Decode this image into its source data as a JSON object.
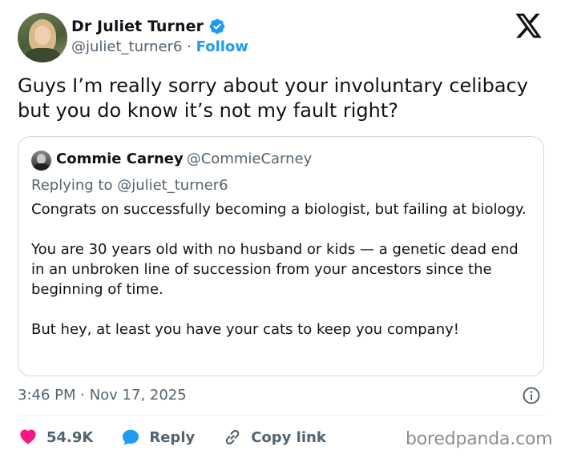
{
  "author": {
    "display_name": "Dr Juliet Turner",
    "handle": "@juliet_turner6",
    "separator": "·",
    "follow_label": "Follow"
  },
  "tweet": {
    "text": "Guys I’m really sorry about your involuntary celibacy but you do know it’s not my fault right?"
  },
  "quote": {
    "name": "Commie Carney",
    "handle": "@CommieCarney",
    "replying_to": "Replying to @juliet_turner6",
    "paragraphs": [
      "Congrats on successfully becoming a biologist, but failing at biology.",
      "You are 30 years old with no husband or kids — a genetic dead end in an unbroken line of succession from your ancestors since the beginning of time.",
      "But hey, at least you have your cats to keep you company!"
    ]
  },
  "meta": {
    "timestamp": "3:46 PM · Nov 17, 2025"
  },
  "actions": {
    "likes": "54.9K",
    "reply_label": "Reply",
    "copy_link_label": "Copy link"
  },
  "watermark": "boredpanda.com",
  "colors": {
    "accent": "#1d9bf0",
    "like": "#f91880",
    "text": "#0f1419",
    "secondary": "#536471",
    "border": "#cfd9de"
  },
  "icons": {
    "verified": "verified-badge-icon",
    "logo": "x-logo-icon",
    "info": "info-icon",
    "like": "heart-icon",
    "reply": "speech-bubble-icon",
    "copy_link": "link-icon"
  }
}
